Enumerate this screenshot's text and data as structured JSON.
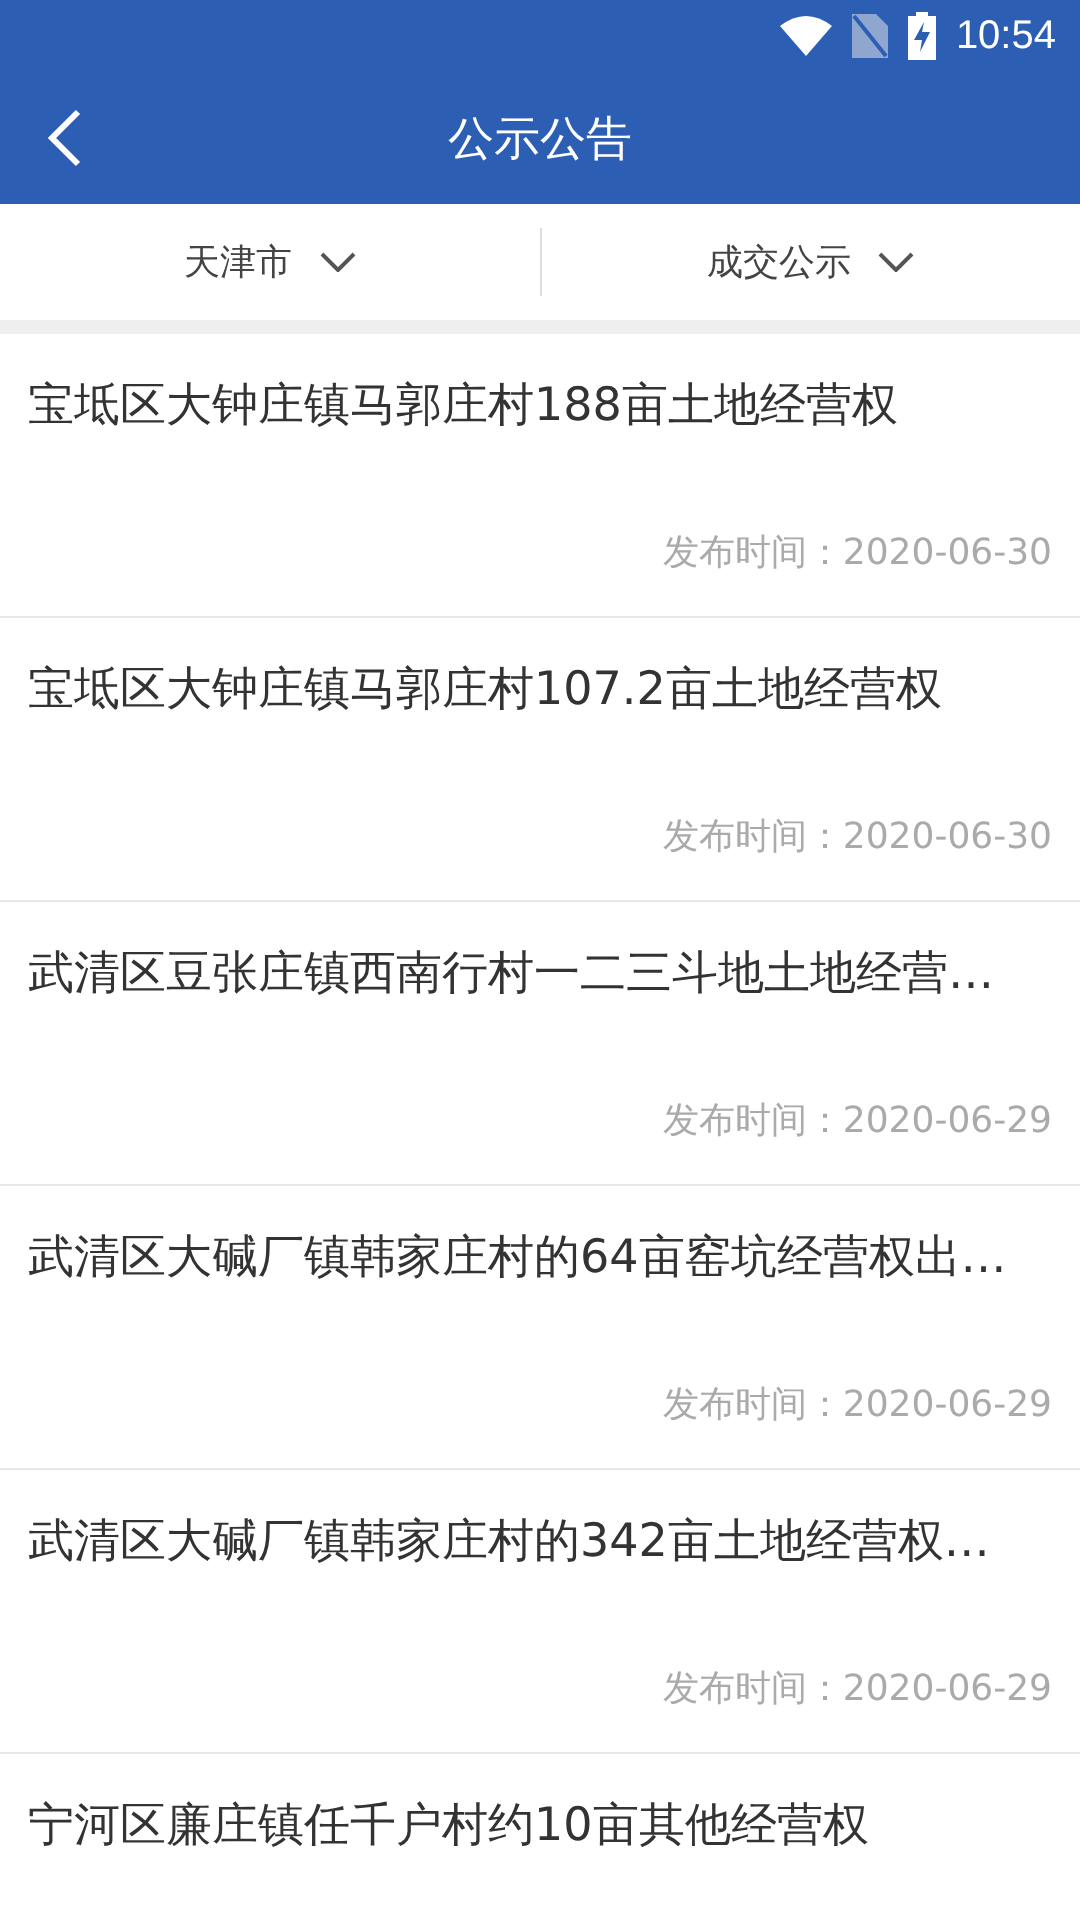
{
  "status_bar": {
    "time": "10:54"
  },
  "header": {
    "title": "公示公告"
  },
  "filters": [
    {
      "label": "天津市"
    },
    {
      "label": "成交公示"
    }
  ],
  "notices": [
    {
      "title": "宝坻区大钟庄镇马郭庄村188亩土地经营权",
      "date": "发布时间：2020-06-30"
    },
    {
      "title": "宝坻区大钟庄镇马郭庄村107.2亩土地经营权",
      "date": "发布时间：2020-06-30"
    },
    {
      "title": "武清区豆张庄镇西南行村一二三斗地土地经营…",
      "date": "发布时间：2020-06-29"
    },
    {
      "title": "武清区大碱厂镇韩家庄村的64亩窑坑经营权出…",
      "date": "发布时间：2020-06-29"
    },
    {
      "title": "武清区大碱厂镇韩家庄村的342亩土地经营权…",
      "date": "发布时间：2020-06-29"
    },
    {
      "title": "宁河区廉庄镇任千户村约10亩其他经营权"
    }
  ]
}
